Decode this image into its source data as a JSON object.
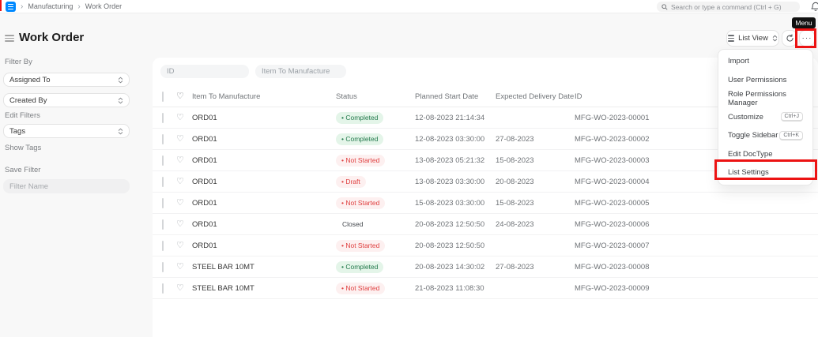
{
  "navbar": {
    "breadcrumb": [
      "Manufacturing",
      "Work Order"
    ],
    "search_placeholder": "Search or type a command (Ctrl + G)"
  },
  "header": {
    "title": "Work Order",
    "list_view_label": "List View",
    "ellipsis_label": "···",
    "menu_tooltip": "Menu"
  },
  "sidebar": {
    "filter_by_label": "Filter By",
    "selects": [
      "Assigned To",
      "Created By"
    ],
    "edit_filters_label": "Edit Filters",
    "tags_select": "Tags",
    "show_tags_label": "Show Tags",
    "save_filter_label": "Save Filter",
    "filter_name_placeholder": "Filter Name"
  },
  "list_filters": {
    "id_placeholder": "ID",
    "item_placeholder": "Item To Manufacture"
  },
  "table": {
    "columns": [
      "Item To Manufacture",
      "Status",
      "Planned Start Date",
      "Expected Delivery Date",
      "ID"
    ],
    "rows": [
      {
        "item": "ORD01",
        "status": "Completed",
        "variant": "success",
        "planned_start": "12-08-2023 21:14:34",
        "expected_delivery": "",
        "id": "MFG-WO-2023-00001"
      },
      {
        "item": "ORD01",
        "status": "Completed",
        "variant": "success",
        "planned_start": "12-08-2023 03:30:00",
        "expected_delivery": "27-08-2023",
        "id": "MFG-WO-2023-00002"
      },
      {
        "item": "ORD01",
        "status": "Not Started",
        "variant": "danger",
        "planned_start": "13-08-2023 05:21:32",
        "expected_delivery": "15-08-2023",
        "id": "MFG-WO-2023-00003"
      },
      {
        "item": "ORD01",
        "status": "Draft",
        "variant": "danger",
        "planned_start": "13-08-2023 03:30:00",
        "expected_delivery": "20-08-2023",
        "id": "MFG-WO-2023-00004"
      },
      {
        "item": "ORD01",
        "status": "Not Started",
        "variant": "danger",
        "planned_start": "15-08-2023 03:30:00",
        "expected_delivery": "15-08-2023",
        "id": "MFG-WO-2023-00005"
      },
      {
        "item": "ORD01",
        "status": "Closed",
        "variant": "plain",
        "planned_start": "20-08-2023 12:50:50",
        "expected_delivery": "24-08-2023",
        "id": "MFG-WO-2023-00006"
      },
      {
        "item": "ORD01",
        "status": "Not Started",
        "variant": "danger",
        "planned_start": "20-08-2023 12:50:50",
        "expected_delivery": "",
        "id": "MFG-WO-2023-00007"
      },
      {
        "item": "STEEL BAR 10MT",
        "status": "Completed",
        "variant": "success",
        "planned_start": "20-08-2023 14:30:02",
        "expected_delivery": "27-08-2023",
        "id": "MFG-WO-2023-00008"
      },
      {
        "item": "STEEL BAR 10MT",
        "status": "Not Started",
        "variant": "danger",
        "planned_start": "21-08-2023 11:08:30",
        "expected_delivery": "",
        "id": "MFG-WO-2023-00009"
      }
    ]
  },
  "menu": {
    "items": [
      {
        "label": "Import"
      },
      {
        "label": "User Permissions"
      },
      {
        "label": "Role Permissions Manager"
      },
      {
        "label": "Customize",
        "shortcut": "Ctrl+J"
      },
      {
        "label": "Toggle Sidebar",
        "shortcut": "Ctrl+K"
      },
      {
        "label": "Edit DocType"
      },
      {
        "label": "List Settings",
        "highlighted": true
      }
    ]
  },
  "icons": {
    "heart": "♡",
    "breadcrumb_chevron": "›"
  },
  "colors": {
    "accent_blue": "#0089ff",
    "annotation_red": "#ec1313",
    "success_text": "#247a4d",
    "success_bg": "#e4f5e9",
    "danger_text": "#df3e3e",
    "danger_bg": "#fdf0f0"
  }
}
